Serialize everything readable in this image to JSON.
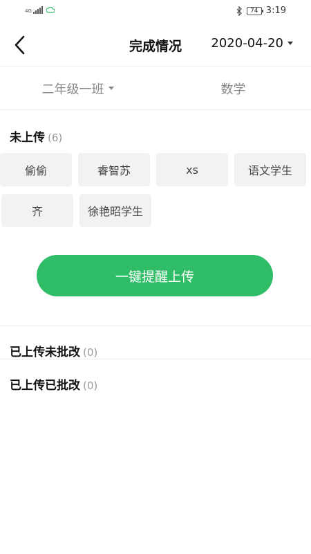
{
  "status_bar": {
    "network": "4G",
    "battery": "74",
    "time": "3:19"
  },
  "header": {
    "title": "完成情况",
    "date": "2020-04-20"
  },
  "filters": {
    "class_name": "二年级一班",
    "subject": "数学"
  },
  "not_uploaded": {
    "title": "未上传",
    "count": "(6)",
    "students": [
      "偷偷",
      "睿智苏",
      "xs",
      "语文学生",
      "齐",
      "徐艳昭学生"
    ]
  },
  "remind_button": {
    "label": "一键提醒上传"
  },
  "uploaded_unreviewed": {
    "title": "已上传未批改",
    "count": "(0)"
  },
  "uploaded_reviewed": {
    "title": "已上传已批改",
    "count": "(0)"
  },
  "colors": {
    "accent": "#2fbd67"
  }
}
